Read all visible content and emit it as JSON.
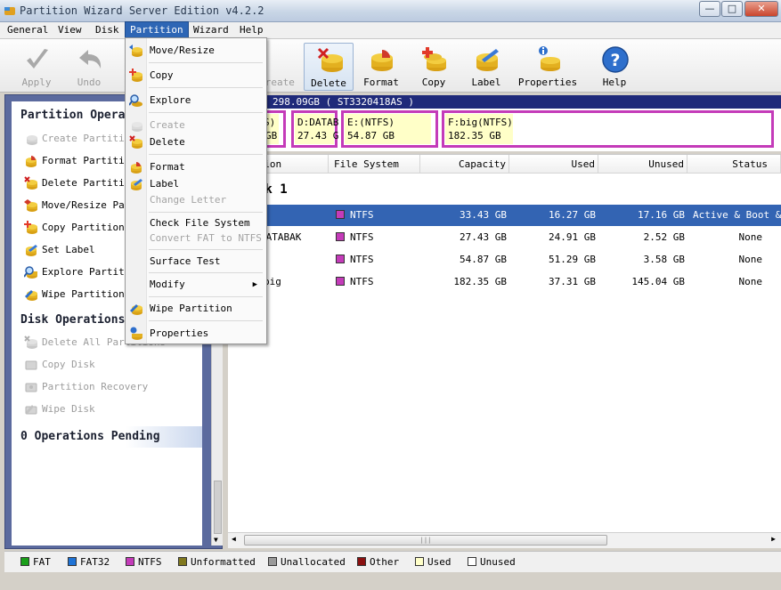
{
  "window": {
    "title": "Partition Wizard Server Edition v4.2.2"
  },
  "menubar": [
    "General",
    "View",
    "Disk",
    "Partition",
    "Wizard",
    "Help"
  ],
  "active_menu": "Partition",
  "toolbar": {
    "apply": "Apply",
    "undo": "Undo",
    "create": "Create",
    "delete": "Delete",
    "format": "Format",
    "copy": "Copy",
    "label": "Label",
    "properties": "Properties",
    "help": "Help"
  },
  "partition_menu": {
    "items": [
      {
        "label": "Move/Resize",
        "enabled": true
      },
      {
        "label": "Copy",
        "enabled": true
      },
      {
        "label": "Explore",
        "enabled": true
      },
      {
        "label": "Create",
        "enabled": false
      },
      {
        "label": "Delete",
        "enabled": true
      },
      {
        "label": "Format",
        "enabled": true
      },
      {
        "label": "Label",
        "enabled": true
      },
      {
        "label": "Change Letter",
        "enabled": false
      },
      {
        "label": "Check File System",
        "enabled": true
      },
      {
        "label": "Convert FAT to NTFS",
        "enabled": false
      },
      {
        "label": "Surface Test",
        "enabled": true
      },
      {
        "label": "Modify",
        "enabled": true
      },
      {
        "label": "Wipe Partition",
        "enabled": true
      },
      {
        "label": "Properties",
        "enabled": true
      }
    ]
  },
  "left_panel": {
    "partition_ops": {
      "title": "Partition Operations",
      "items": [
        "Create Partition",
        "Format Partition",
        "Delete Partition",
        "Move/Resize Partition",
        "Copy Partition",
        "Set Label",
        "Explore Partition",
        "Wipe Partition"
      ]
    },
    "disk_ops": {
      "title": "Disk Operations",
      "items": [
        "Delete All Partitions",
        "Copy Disk",
        "Partition Recovery",
        "Wipe Disk"
      ]
    },
    "pending": {
      "title": "0 Operations Pending"
    }
  },
  "disk_map": {
    "header": "298.09GB   ( ST3320418AS )",
    "partitions": [
      {
        "line1": "S)",
        "line2": "GB"
      },
      {
        "line1": "D:DATAB",
        "line2": "27.43 G"
      },
      {
        "line1": "E:(NTFS)",
        "line2": "54.87 GB"
      },
      {
        "line1": "F:big(NTFS)",
        "line2": "182.35 GB"
      }
    ]
  },
  "grid": {
    "columns": [
      "ition",
      "File System",
      "Capacity",
      "Used",
      "Unused",
      "Status"
    ],
    "disk_label": "sk 1",
    "rows": [
      {
        "name": "",
        "fs": "NTFS",
        "capacity": "33.43 GB",
        "used": "16.27 GB",
        "unused": "17.16 GB",
        "status": "Active & Boot & S"
      },
      {
        "name": "DATABAK",
        "fs": "NTFS",
        "capacity": "27.43 GB",
        "used": "24.91 GB",
        "unused": "2.52 GB",
        "status": "None"
      },
      {
        "name": "",
        "fs": "NTFS",
        "capacity": "54.87 GB",
        "used": "51.29 GB",
        "unused": "3.58 GB",
        "status": "None"
      },
      {
        "name": "big",
        "fs": "NTFS",
        "capacity": "182.35 GB",
        "used": "37.31 GB",
        "unused": "145.04 GB",
        "status": "None"
      }
    ]
  },
  "legend": [
    {
      "label": "FAT",
      "color": "#1a9f1a"
    },
    {
      "label": "FAT32",
      "color": "#1f73d6"
    },
    {
      "label": "NTFS",
      "color": "#c43bb9"
    },
    {
      "label": "Unformatted",
      "color": "#80781e"
    },
    {
      "label": "Unallocated",
      "color": "#9a9a9a"
    },
    {
      "label": "Other",
      "color": "#8a1010"
    },
    {
      "label": "Used",
      "color": "#ffffc8"
    },
    {
      "label": "Unused",
      "color": "#ffffff"
    }
  ],
  "colors": {
    "ntfs": "#c43bb9",
    "selection": "#3364b3",
    "panel": "#5b6a9e"
  }
}
